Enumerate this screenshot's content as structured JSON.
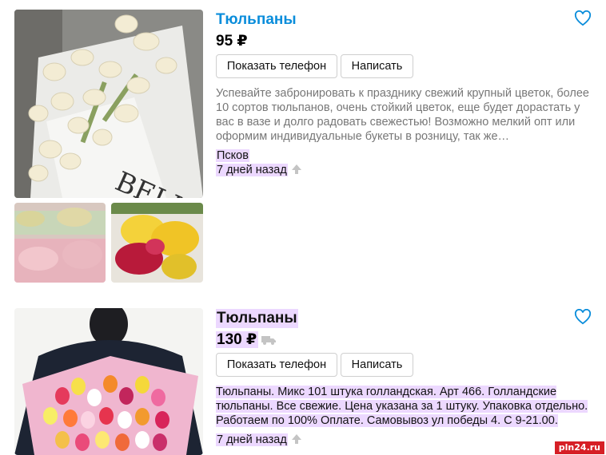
{
  "listings": [
    {
      "title": "Тюльпаны",
      "price": "95 ₽",
      "phone_button": "Показать телефон",
      "message_button": "Написать",
      "description": "Успевайте забронировать к празднику свежий крупный цветок, более 10 сортов тюльпанов, очень стойкий цветок, еще будет дорастать у вас в вазе и долго радовать свежестью! Возможно мелкий опт или оформим индивидуальные букеты в розницу, так же…",
      "location": "Псков",
      "date": "7 дней назад",
      "photo_text": "BELLE"
    },
    {
      "title": "Тюльпаны",
      "price": "130 ₽",
      "phone_button": "Показать телефон",
      "message_button": "Написать",
      "description_lines": [
        "Тюльпаны. Микс 101 штука голландская. Арт 466. Голландские",
        "тюльпаны. Все свежие. Цена указана за 1 штуку. Упаковка отдельно.",
        "Работаем по 100% Оплате. Самовывоз ул победы 4. С 9-21.00."
      ],
      "date": "7 дней назад"
    }
  ],
  "watermark": "pln24.ru",
  "colors": {
    "title": "#0a8ddb",
    "highlight": "#ecd8ff",
    "heart": "#0a8ddb"
  },
  "icons": [
    "heart-icon",
    "up-arrow-icon",
    "truck-icon"
  ]
}
